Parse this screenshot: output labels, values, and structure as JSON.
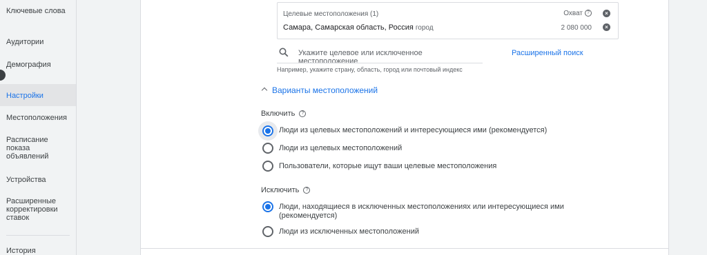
{
  "sidebar": {
    "items": [
      {
        "label": "Ключевые слова",
        "active": false
      },
      {
        "label": "Аудитории",
        "active": false
      },
      {
        "label": "Демография",
        "active": false
      },
      {
        "label": "Настройки",
        "active": true
      },
      {
        "label": "Местоположения",
        "active": false
      },
      {
        "label": "Расписание показа объявлений",
        "active": false
      },
      {
        "label": "Устройства",
        "active": false
      },
      {
        "label": "Расширенные корректировки ставок",
        "active": false
      },
      {
        "label": "История",
        "active": false
      }
    ]
  },
  "targets": {
    "header": "Целевые местоположения (1)",
    "reach_label": "Охват",
    "rows": [
      {
        "name": "Самара, Самарская область, Россия",
        "type": "город",
        "reach": "2 080 000"
      }
    ]
  },
  "search": {
    "placeholder": "Укажите целевое или исключенное местоположение",
    "hint": "Например, укажите страну, область, город или почтовый индекс",
    "advanced_link": "Расширенный поиск"
  },
  "options_section": {
    "title": "Варианты местоположений"
  },
  "include": {
    "label": "Включить",
    "options": [
      {
        "label": "Люди из целевых местоположений и интересующиеся ими (рекомендуется)",
        "selected": true
      },
      {
        "label": "Люди из целевых местоположений",
        "selected": false
      },
      {
        "label": "Пользователи, которые ищут ваши целевые местоположения",
        "selected": false
      }
    ]
  },
  "exclude": {
    "label": "Исключить",
    "options": [
      {
        "label": "Люди, находящиеся в исключенных местоположениях или интересующиеся ими (рекомендуется)",
        "selected": true
      },
      {
        "label": "Люди из исключенных местоположений",
        "selected": false
      }
    ]
  },
  "colors": {
    "accent": "#1a73e8",
    "text": "#3c4043",
    "muted": "#5f6368",
    "border": "#dadce0"
  }
}
